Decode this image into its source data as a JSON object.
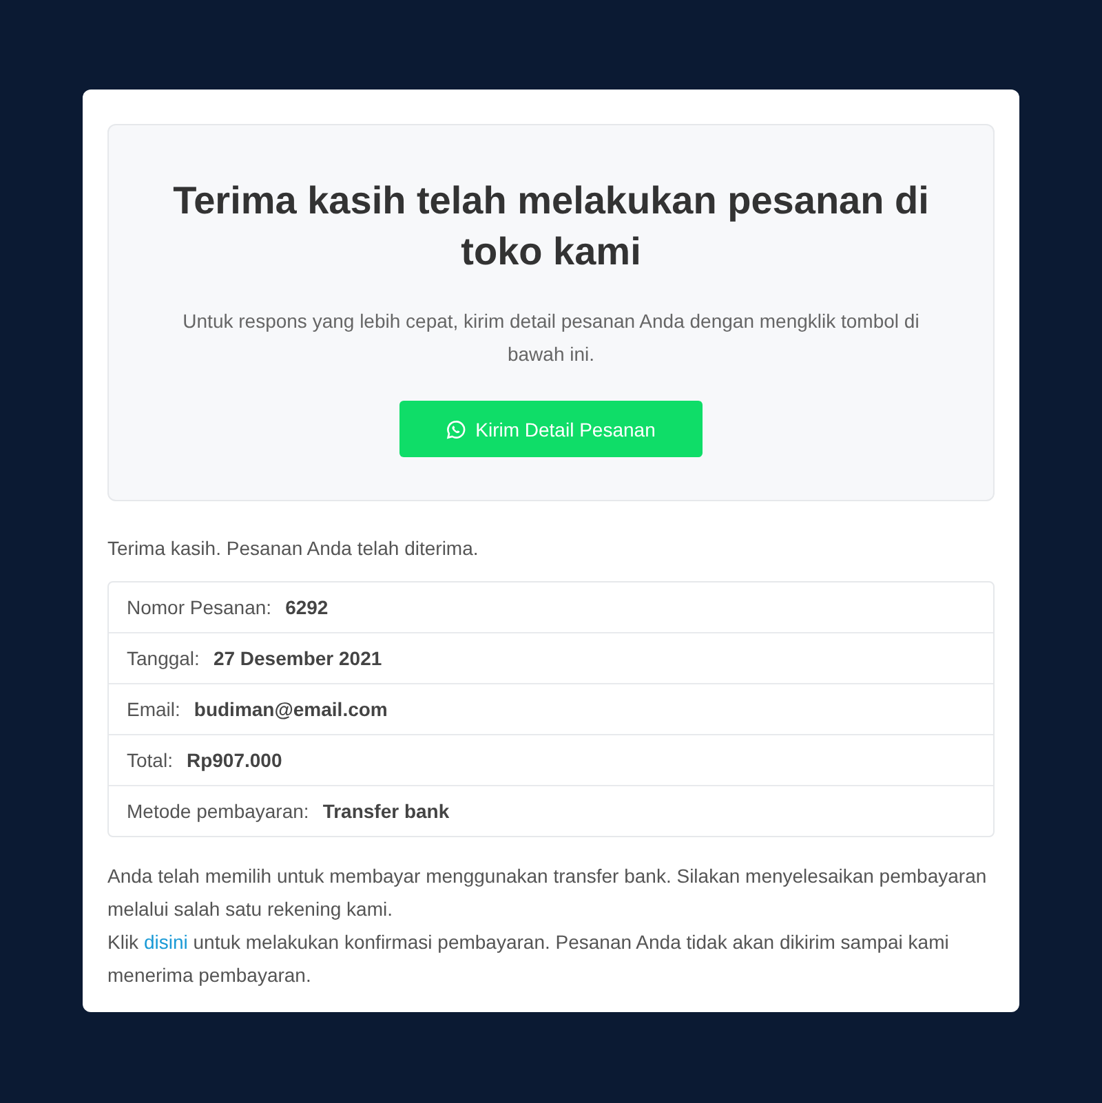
{
  "hero": {
    "title": "Terima kasih telah melakukan pesanan di toko kami",
    "subtitle": "Untuk respons yang lebih cepat, kirim detail pesanan Anda dengan mengklik tombol di bawah ini.",
    "button": "Kirim Detail Pesanan"
  },
  "confirmation": "Terima kasih. Pesanan Anda telah diterima.",
  "details": [
    {
      "label": "Nomor Pesanan:",
      "value": "6292"
    },
    {
      "label": "Tanggal:",
      "value": "27 Desember 2021"
    },
    {
      "label": "Email:",
      "value": "budiman@email.com"
    },
    {
      "label": "Total:",
      "value": "Rp907.000"
    },
    {
      "label": "Metode pembayaran:",
      "value": "Transfer bank"
    }
  ],
  "instructions": "Anda telah memilih untuk membayar menggunakan transfer bank. Silakan menyelesaikan pembayaran melalui salah satu rekening kami.",
  "confirm_note": {
    "before": "Klik",
    "link": "disini",
    "after": "untuk melakukan konfirmasi pembayaran. Pesanan Anda tidak akan dikirim sampai kami menerima pembayaran."
  }
}
